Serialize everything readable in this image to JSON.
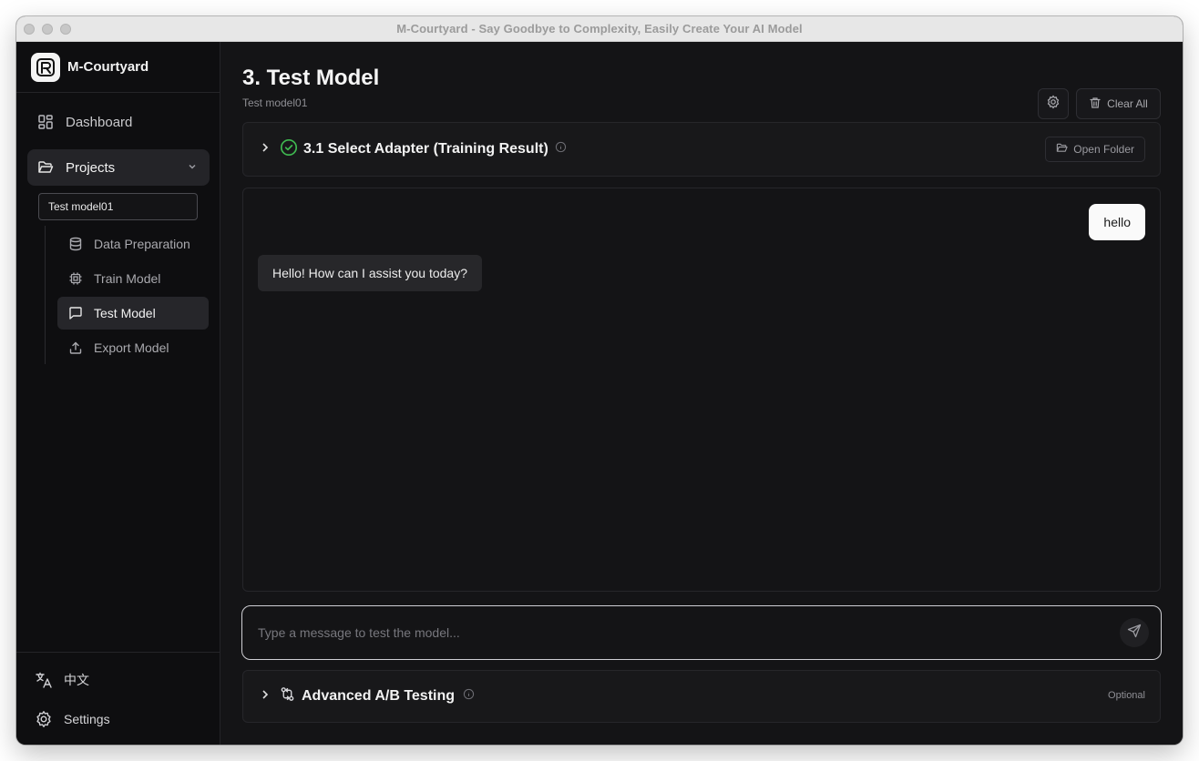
{
  "window": {
    "title": "M-Courtyard - Say Goodbye to Complexity, Easily Create Your AI Model"
  },
  "sidebar": {
    "brand": "M-Courtyard",
    "dashboard_label": "Dashboard",
    "projects_label": "Projects",
    "project_select_value": "Test model01",
    "subitems": [
      {
        "label": "Data Preparation",
        "icon": "database-icon"
      },
      {
        "label": "Train Model",
        "icon": "cpu-icon"
      },
      {
        "label": "Test Model",
        "icon": "message-icon",
        "active": true
      },
      {
        "label": "Export Model",
        "icon": "upload-icon"
      }
    ],
    "language_label": "中文",
    "settings_label": "Settings"
  },
  "main": {
    "title": "3. Test Model",
    "subtitle": "Test model01",
    "clear_all_label": "Clear All",
    "adapter_panel": {
      "title": "3.1 Select Adapter (Training Result)",
      "open_folder_label": "Open Folder",
      "status": "done"
    },
    "chat": {
      "messages": [
        {
          "role": "user",
          "text": "hello"
        },
        {
          "role": "assistant",
          "text": "Hello! How can I assist you today?"
        }
      ]
    },
    "composer": {
      "placeholder": "Type a message to test the model...",
      "value": ""
    },
    "ab_panel": {
      "title": "Advanced A/B Testing",
      "badge": "Optional"
    }
  },
  "colors": {
    "background": "#141416",
    "sidebar": "#0e0e10",
    "success": "#3fb950",
    "user_bubble": "#fafafa",
    "assistant_bubble": "#27272a"
  }
}
